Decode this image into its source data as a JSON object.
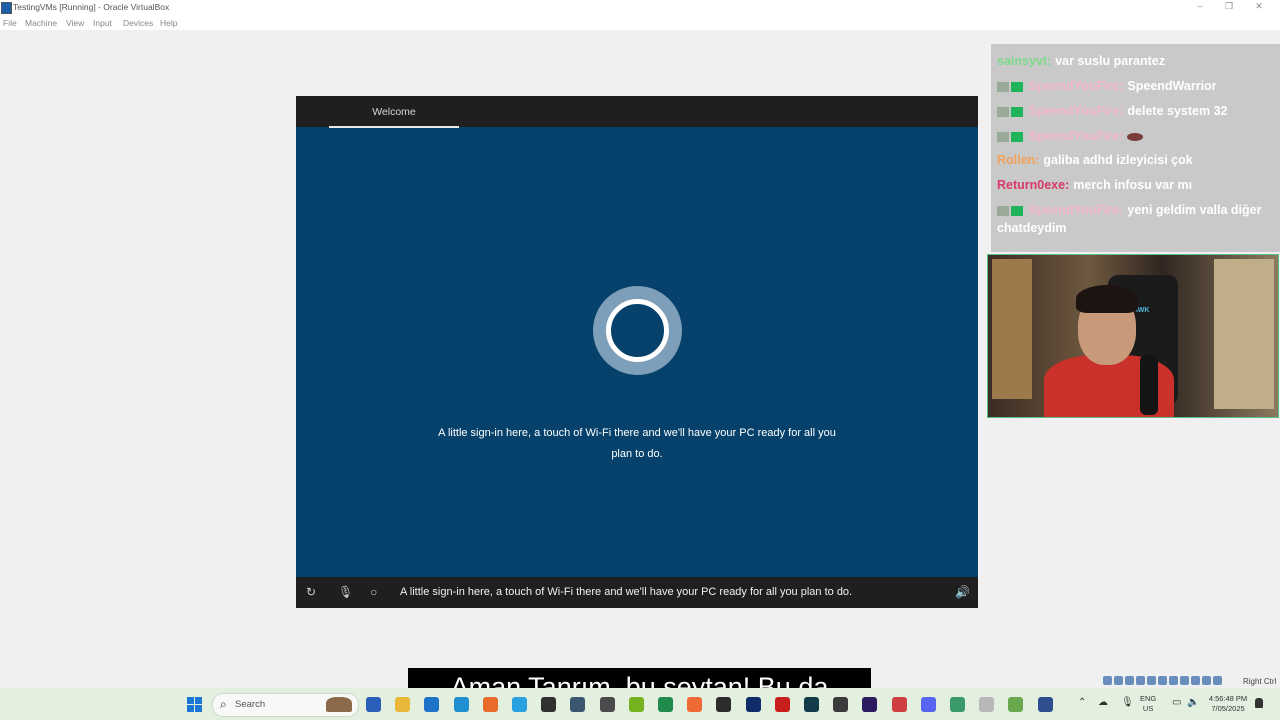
{
  "window": {
    "title": "TestingVMs [Running] - Oracle VirtualBox",
    "controls": [
      "–",
      "❐",
      "✕"
    ]
  },
  "menu": [
    "File",
    "Machine",
    "View",
    "Input",
    "Devices",
    "Help"
  ],
  "vm": {
    "tab": "Welcome",
    "message_line1": "A little sign-in here, a touch of Wi-Fi there and we'll have your PC ready for all you",
    "message_line2": "plan to do.",
    "bottom_caption": "A little sign-in here, a touch of Wi-Fi there and we'll have your PC ready for all you plan to do.",
    "icons": [
      "accessibility-icon",
      "microphone-icon",
      "cortana-icon",
      "volume-icon"
    ]
  },
  "chat": [
    {
      "user": "sainsyvt:",
      "text": "var suslu parantez",
      "user_color": "#7fd98a",
      "badges": 0
    },
    {
      "user": "SpeendYouFire:",
      "text": "SpeendWarrior",
      "user_color": "#f4b6cf",
      "badges": 2
    },
    {
      "user": "SpeendYouFire:",
      "text": "delete system 32",
      "user_color": "#f4b6cf",
      "badges": 2
    },
    {
      "user": "SpeendYouFire:",
      "text": "",
      "user_color": "#f4b6cf",
      "badges": 2,
      "emote": true
    },
    {
      "user": "Rollen:",
      "text": "galiba adhd izleyicisi çok",
      "user_color": "#f2a25a",
      "badges": 0
    },
    {
      "user": "Return0exe:",
      "text": "merch infosu var mı",
      "user_color": "#d93a68",
      "badges": 0
    },
    {
      "user": "SpeendYouFire:",
      "text": "yeni geldim valla diğer chatdeydim",
      "user_color": "#f4b6cf",
      "badges": 2
    }
  ],
  "webcam": {
    "chair_text": "HAWK"
  },
  "subtitle": "Aman Tanrım, bu şeytan!  Bu da",
  "vm_status": {
    "host_key": "Right Ctrl"
  },
  "taskbar": {
    "search_placeholder": "Search",
    "apps": [
      {
        "name": "word-app",
        "color": "#2b5eb8"
      },
      {
        "name": "file-explorer-app",
        "color": "#e9b73a"
      },
      {
        "name": "outlook-app",
        "color": "#1e73c8"
      },
      {
        "name": "edge-app",
        "color": "#1f8fd1"
      },
      {
        "name": "firefox-app",
        "color": "#e86b2c"
      },
      {
        "name": "vscode-app",
        "color": "#2aa1e0"
      },
      {
        "name": "obs-app",
        "color": "#303030"
      },
      {
        "name": "steam-app",
        "color": "#3b5670"
      },
      {
        "name": "gpu-app",
        "color": "#4a4a4a"
      },
      {
        "name": "nvidia-app",
        "color": "#74b31f"
      },
      {
        "name": "excel-app",
        "color": "#1f8a4c"
      },
      {
        "name": "brave-app",
        "color": "#f06a35"
      },
      {
        "name": "terminal-app",
        "color": "#2c2c2c"
      },
      {
        "name": "photoshop-app",
        "color": "#0f2d6a"
      },
      {
        "name": "acrobat-app",
        "color": "#c81e1e"
      },
      {
        "name": "audition-app",
        "color": "#123b4a"
      },
      {
        "name": "media-app",
        "color": "#3a3a3a"
      },
      {
        "name": "premiere-app",
        "color": "#2b1a5e"
      },
      {
        "name": "app-red",
        "color": "#d04040"
      },
      {
        "name": "discord-app",
        "color": "#5865f2"
      },
      {
        "name": "sheets-app",
        "color": "#3a9a6a"
      },
      {
        "name": "settings-app",
        "color": "#b8b8b8"
      },
      {
        "name": "vs-app",
        "color": "#6aa84f"
      },
      {
        "name": "virtualbox-app",
        "color": "#2d4f8f"
      }
    ],
    "lang_line1": "ENG",
    "lang_line2": "US",
    "time": "4:56:48 PM",
    "date": "7/05/2025"
  }
}
